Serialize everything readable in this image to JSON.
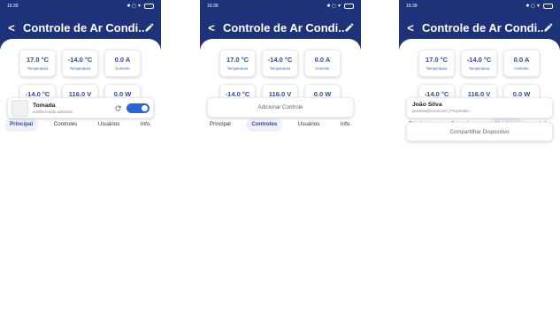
{
  "status": {
    "time": "16:39",
    "icons": "✱ ▢ ▼"
  },
  "screens": [
    {
      "title": "Controle de Ar Condi...",
      "metrics": [
        {
          "value": "17.0 °C",
          "label": "Temperatura"
        },
        {
          "value": "-14.0 °C",
          "label": "Temperatura"
        },
        {
          "value": "0.0 A",
          "label": "Corrente"
        },
        {
          "value": "-14.0 °C",
          "label": "Temperatura"
        },
        {
          "value": "116.0 V",
          "label": "Tensão"
        },
        {
          "value": "0.0 W",
          "label": "Potência"
        }
      ],
      "tabs": [
        "Principal",
        "Controles",
        "Usuários",
        "Info."
      ],
      "active_tab": 0,
      "device": {
        "name": "Tomada",
        "subtitle": "Info/Descrição adicional",
        "toggle_on": true
      }
    },
    {
      "title": "Controle de Ar Condi...",
      "metrics": [
        {
          "value": "17.0 °C",
          "label": "Temperatura"
        },
        {
          "value": "-14.0 °C",
          "label": "Temperatura"
        },
        {
          "value": "0.0 A",
          "label": "Corrente"
        },
        {
          "value": "-14.0 °C",
          "label": "Temperatura"
        },
        {
          "value": "116.0 V",
          "label": "Tensão"
        },
        {
          "value": "0.0 W",
          "label": "Potência"
        }
      ],
      "tabs": [
        "Principal",
        "Controles",
        "Usuários",
        "Info."
      ],
      "active_tab": 1,
      "add_control_label": "Adicionar Controle"
    },
    {
      "title": "Controle de Ar Condi...",
      "metrics": [
        {
          "value": "17.0 °C",
          "label": "Temperatura"
        },
        {
          "value": "-14.0 °C",
          "label": "Temperatura"
        },
        {
          "value": "0.0 A",
          "label": "Corrente"
        },
        {
          "value": "-14.0 °C",
          "label": "Temperatura"
        },
        {
          "value": "116.0 V",
          "label": "Tensão"
        },
        {
          "value": "0.0 W",
          "label": "Potência"
        }
      ],
      "tabs": [
        "Principal",
        "Controles",
        "Usuários",
        "Info."
      ],
      "active_tab": 2,
      "user": {
        "name": "João Silva",
        "subtitle": "joaosilva@email.com | Proprietário"
      },
      "share_label": "Compartilhar Dispositivo"
    }
  ],
  "colors": {
    "header": "#1d3278",
    "accent": "#2a4aa8",
    "toggle": "#2c63d6"
  }
}
